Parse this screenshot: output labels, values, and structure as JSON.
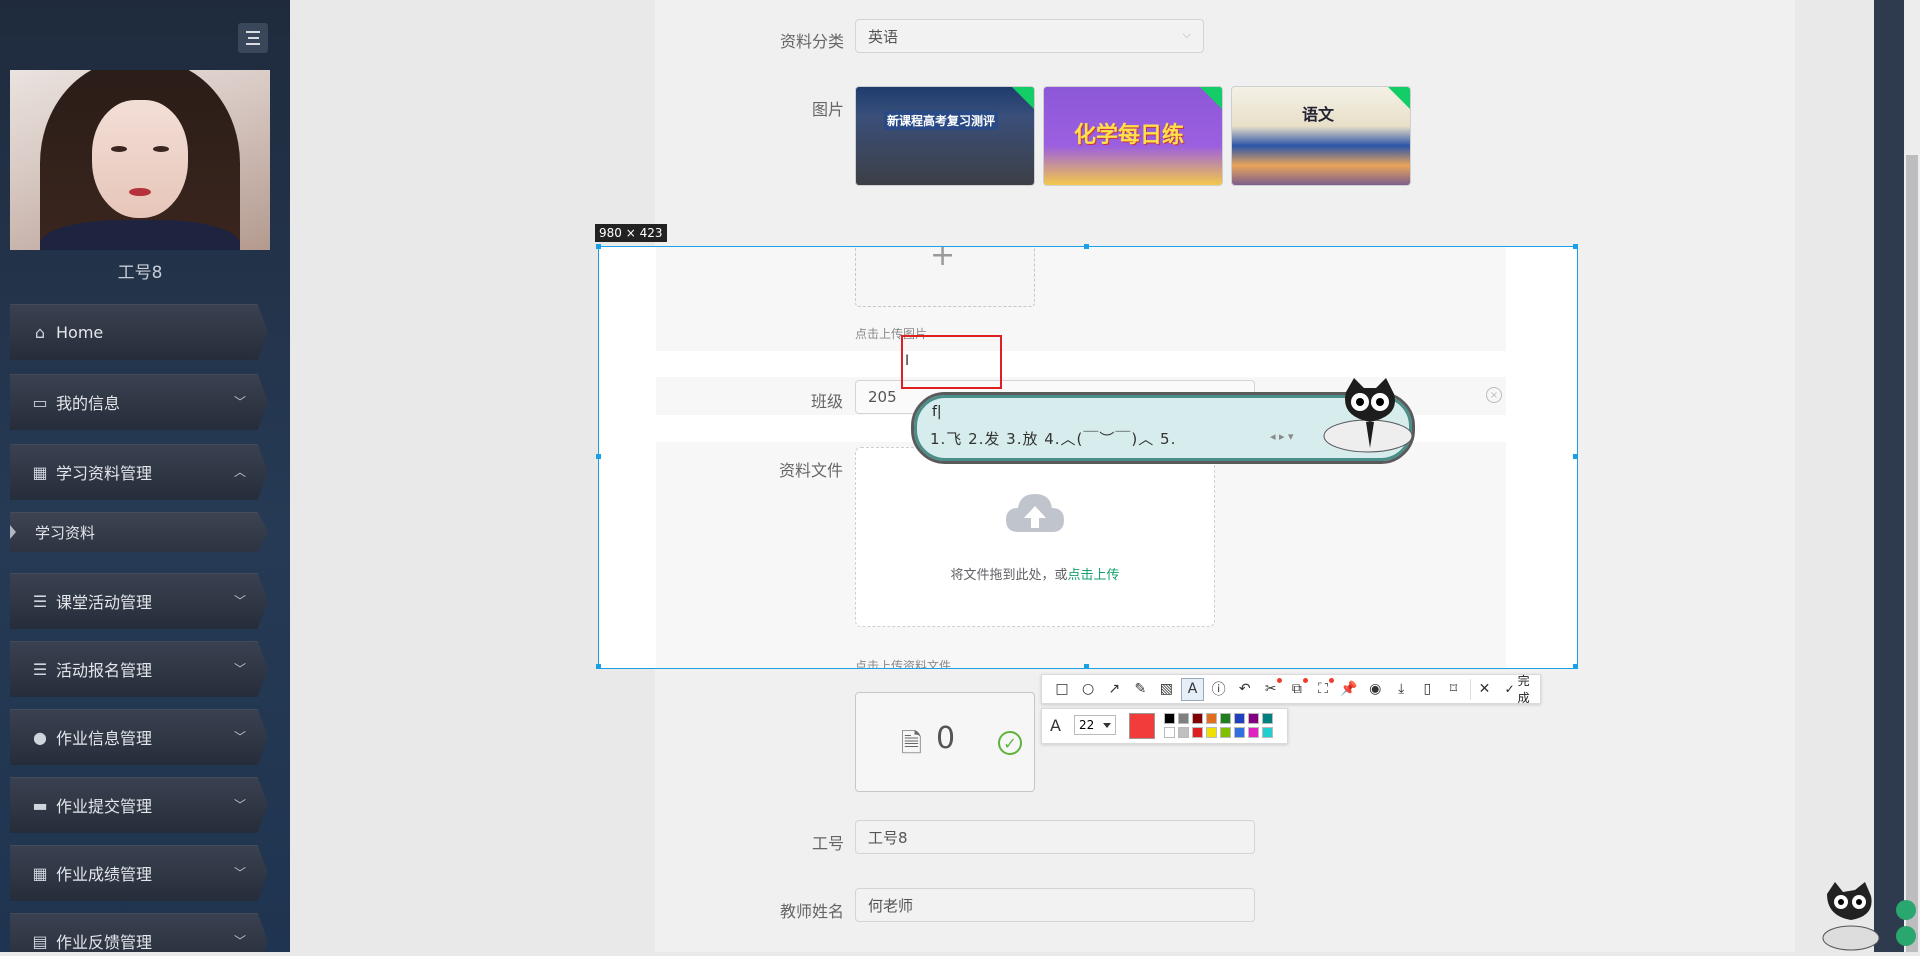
{
  "sidebar": {
    "user_name": "工号8",
    "items": [
      {
        "label": "Home",
        "icon": "home-icon"
      },
      {
        "label": "我的信息",
        "icon": "id-card-icon"
      },
      {
        "label": "学习资料管理",
        "icon": "grid-icon"
      },
      {
        "label": "学习资料",
        "icon": "triangle-icon"
      },
      {
        "label": "课堂活动管理",
        "icon": "list-icon"
      },
      {
        "label": "活动报名管理",
        "icon": "list-icon"
      },
      {
        "label": "作业信息管理",
        "icon": "bulb-icon"
      },
      {
        "label": "作业提交管理",
        "icon": "chat-icon"
      },
      {
        "label": "作业成绩管理",
        "icon": "grid-icon"
      },
      {
        "label": "作业反馈管理",
        "icon": "clipboard-icon"
      }
    ]
  },
  "form": {
    "category_label": "资料分类",
    "category_value": "英语",
    "image_label": "图片",
    "image_thumbs": [
      "新课程高考复习测评",
      "化学每日练",
      "语文"
    ],
    "image_upload_hint": "点击上传图片",
    "class_label": "班级",
    "class_value": "205",
    "file_label": "资料文件",
    "file_drop_text": "将文件拖到此处，或",
    "file_drop_link": "点击上传",
    "file_upload_hint": "点击上传资料文件",
    "file_count": "0",
    "staff_id_label": "工号",
    "staff_id_value": "工号8",
    "teacher_label": "教师姓名",
    "teacher_value": "何老师"
  },
  "capture": {
    "size_label": "980 × 423",
    "ime_input": "f|",
    "ime_candidates": "1.飞  2.发  3.放  4.︿(￣︶￣)︿  5.",
    "done_label": "完成",
    "font_size": "22",
    "current_color": "#f23c3c",
    "palette_top": [
      "#000000",
      "#808080",
      "#800000",
      "#e07020",
      "#208020",
      "#2040c0",
      "#800080",
      "#008080"
    ],
    "palette_bottom": [
      "#ffffff",
      "#c0c0c0",
      "#e02020",
      "#f0e000",
      "#80c000",
      "#3070e0",
      "#e020c0",
      "#20d0d0"
    ]
  },
  "colors": {
    "accent_green": "#13ce66",
    "selection_blue": "#1aa0e6",
    "draw_red": "#e02020"
  }
}
